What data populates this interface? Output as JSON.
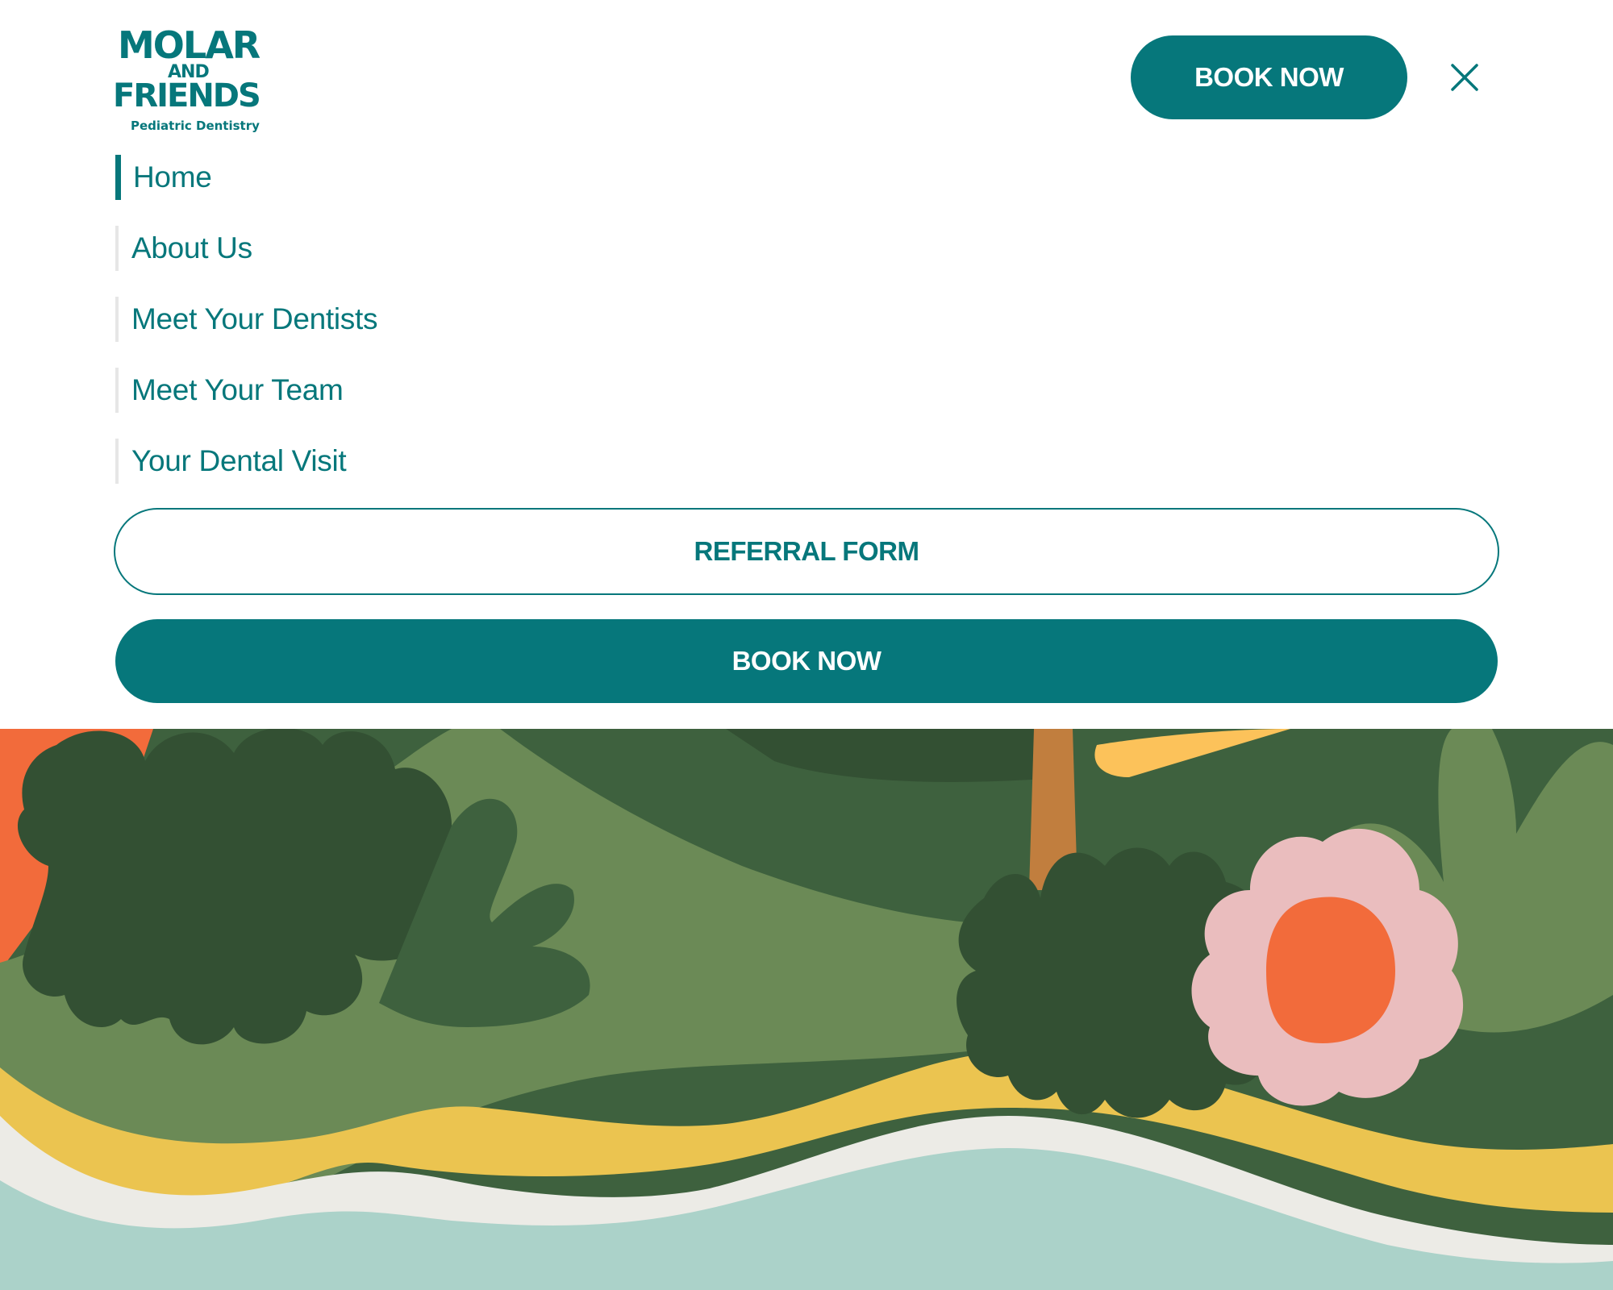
{
  "brand": {
    "logo_line1": "MOLAR",
    "logo_line2": "AND",
    "logo_line3": "FRIENDS",
    "tagline": "Pediatric Dentistry"
  },
  "header": {
    "book_label": "BOOK NOW",
    "close_icon": "close-icon"
  },
  "nav": {
    "active_index": 0,
    "items": [
      {
        "label": "Home"
      },
      {
        "label": "About Us"
      },
      {
        "label": "Meet Your Dentists"
      },
      {
        "label": "Meet Your Team"
      },
      {
        "label": "Your Dental Visit"
      }
    ]
  },
  "actions": {
    "referral_label": "REFERRAL FORM",
    "book_label": "BOOK NOW"
  },
  "colors": {
    "brand_teal": "#06777b",
    "white": "#ffffff",
    "grass_light": "#6b8a56",
    "grass_mid": "#3e613e",
    "grass_dark": "#335033",
    "sand": "#ebc450",
    "foam": "#ecebe6",
    "water": "#abd2c9",
    "sun_orange": "#f26b3b",
    "flower_pink": "#eabdbe",
    "trunk": "#c17e3e"
  }
}
